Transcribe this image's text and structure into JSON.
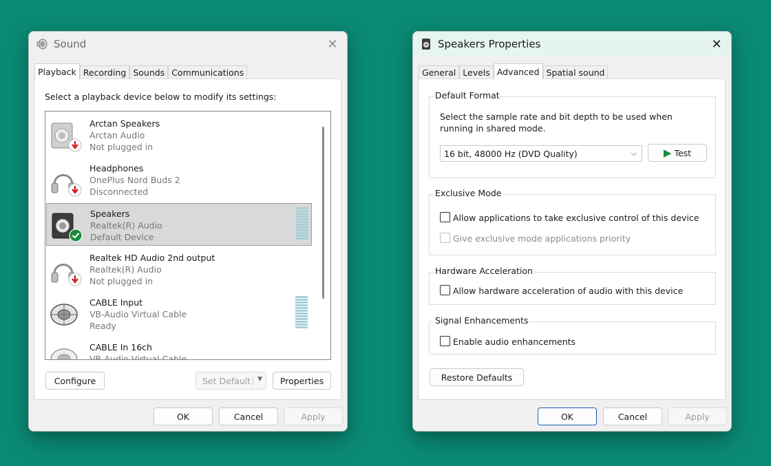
{
  "sound": {
    "title": "Sound",
    "tabs": [
      "Playback",
      "Recording",
      "Sounds",
      "Communications"
    ],
    "instruction": "Select a playback device below to modify its settings:",
    "devices": [
      {
        "name": "Arctan Speakers",
        "driver": "Arctan Audio",
        "status": "Not plugged in",
        "icon": "speaker-icon",
        "badge": "unplugged-arrow"
      },
      {
        "name": "Headphones",
        "driver": "OnePlus Nord Buds 2",
        "status": "Disconnected",
        "icon": "headphones-icon",
        "badge": "unplugged-arrow"
      },
      {
        "name": "Speakers",
        "driver": "Realtek(R) Audio",
        "status": "Default Device",
        "icon": "speaker-icon",
        "badge": "default-check"
      },
      {
        "name": "Realtek HD Audio 2nd output",
        "driver": "Realtek(R) Audio",
        "status": "Not plugged in",
        "icon": "headphones-icon",
        "badge": "unplugged-arrow"
      },
      {
        "name": "CABLE Input",
        "driver": "VB-Audio Virtual Cable",
        "status": "Ready",
        "icon": "cable-icon",
        "badge": ""
      },
      {
        "name": "CABLE In 16ch",
        "driver": "VB-Audio Virtual Cable",
        "status": "",
        "icon": "cable-icon",
        "badge": ""
      }
    ],
    "buttons": {
      "configure": "Configure",
      "set_default": "Set Default",
      "properties": "Properties",
      "ok": "OK",
      "cancel": "Cancel",
      "apply": "Apply"
    }
  },
  "props": {
    "title": "Speakers Properties",
    "tabs": [
      "General",
      "Levels",
      "Advanced",
      "Spatial sound"
    ],
    "default_format": {
      "label": "Default Format",
      "description": "Select the sample rate and bit depth to be used when running in shared mode.",
      "selected": "16 bit, 48000 Hz (DVD Quality)",
      "test_label": "Test"
    },
    "exclusive_mode": {
      "label": "Exclusive Mode",
      "allow_exclusive": "Allow applications to take exclusive control of this device",
      "priority": "Give exclusive mode applications priority"
    },
    "hardware_accel": {
      "label": "Hardware Acceleration",
      "allow": "Allow hardware acceleration of audio with this device"
    },
    "signal": {
      "label": "Signal Enhancements",
      "enable": "Enable audio enhancements"
    },
    "restore_defaults": "Restore Defaults",
    "buttons": {
      "ok": "OK",
      "cancel": "Cancel",
      "apply": "Apply"
    }
  },
  "colors": {
    "desktop": "#0a8a74",
    "accent": "#1a5fb4",
    "check_badge": "#1a8a3a",
    "arrow_badge": "#d42020"
  }
}
